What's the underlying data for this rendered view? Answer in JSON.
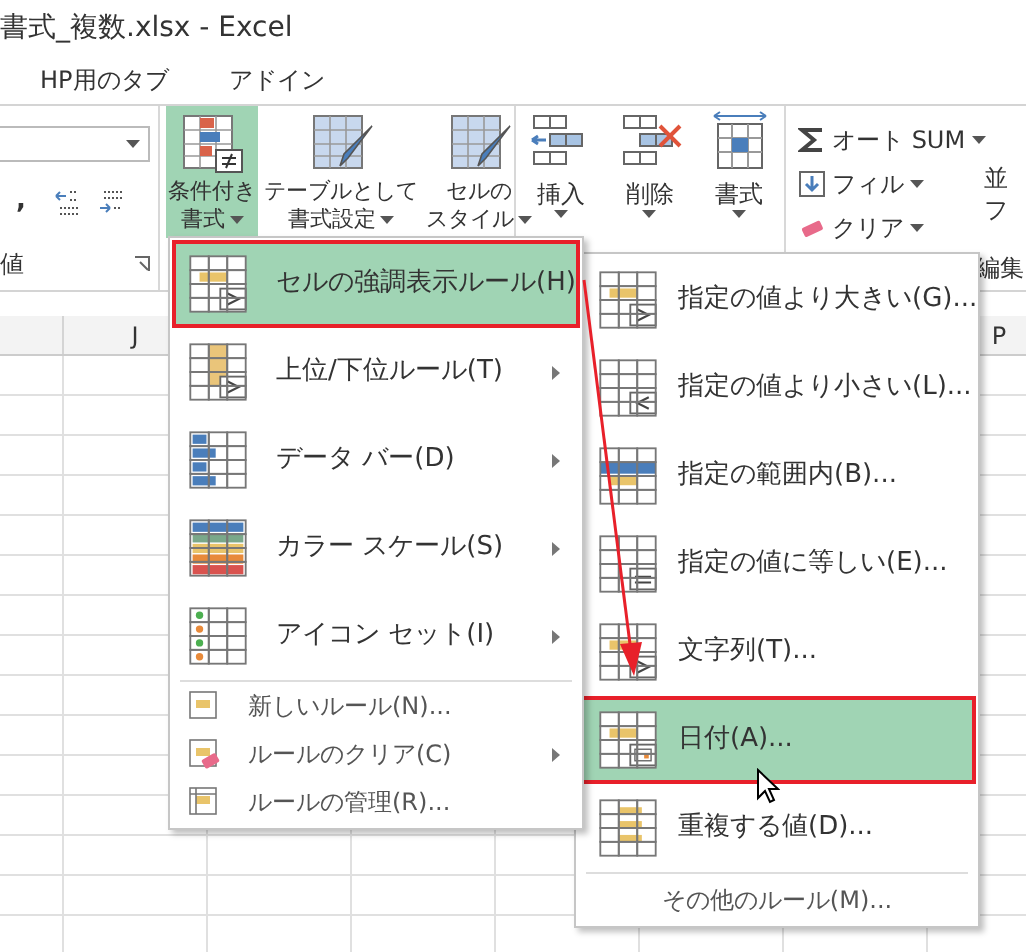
{
  "window": {
    "title": "書式_複数.xlsx - Excel"
  },
  "tabs": [
    {
      "label": "HP用のタブ"
    },
    {
      "label": "アドイン"
    }
  ],
  "number_group": {
    "comma": ",",
    "label": "値"
  },
  "style_buttons": [
    {
      "lines": [
        "条件付き",
        "書式"
      ],
      "selected": true
    },
    {
      "lines": [
        "テーブルとして",
        "書式設定"
      ],
      "selected": false
    },
    {
      "lines": [
        "セルの",
        "スタイル"
      ],
      "selected": false
    }
  ],
  "cell_buttons": [
    {
      "label": "挿入"
    },
    {
      "label": "削除"
    },
    {
      "label": "書式"
    }
  ],
  "editing": {
    "items": [
      {
        "label": "オート SUM"
      },
      {
        "label": "フィル"
      },
      {
        "label": "クリア"
      }
    ],
    "sort_label": [
      "並",
      "フ"
    ],
    "label": "編集"
  },
  "columns": [
    "J",
    "P"
  ],
  "menu": {
    "items": [
      {
        "kind": "large",
        "label": "セルの強調表示ルール(H)",
        "submenu": true,
        "selected": true,
        "annotated": true
      },
      {
        "kind": "large",
        "label": "上位/下位ルール(T)",
        "submenu": true,
        "selected": false,
        "annotated": false
      },
      {
        "kind": "large",
        "label": "データ バー(D)",
        "submenu": true,
        "selected": false,
        "annotated": false
      },
      {
        "kind": "large",
        "label": "カラー スケール(S)",
        "submenu": true,
        "selected": false,
        "annotated": false
      },
      {
        "kind": "large",
        "label": "アイコン セット(I)",
        "submenu": true,
        "selected": false,
        "annotated": false
      },
      {
        "kind": "small",
        "label": "新しいルール(N)...",
        "submenu": false,
        "selected": false,
        "annotated": false
      },
      {
        "kind": "small",
        "label": "ルールのクリア(C)",
        "submenu": true,
        "selected": false,
        "annotated": false
      },
      {
        "kind": "small",
        "label": "ルールの管理(R)...",
        "submenu": false,
        "selected": false,
        "annotated": false
      }
    ]
  },
  "submenu": {
    "items": [
      {
        "label": "指定の値より大きい(G)...",
        "selected": false,
        "annotated": false
      },
      {
        "label": "指定の値より小さい(L)...",
        "selected": false,
        "annotated": false
      },
      {
        "label": "指定の範囲内(B)...",
        "selected": false,
        "annotated": false
      },
      {
        "label": "指定の値に等しい(E)...",
        "selected": false,
        "annotated": false
      },
      {
        "label": "文字列(T)...",
        "selected": false,
        "annotated": false
      },
      {
        "label": "日付(A)...",
        "selected": true,
        "annotated": true
      },
      {
        "label": "重複する値(D)...",
        "selected": false,
        "annotated": false
      }
    ],
    "footer": "その他のルール(M)..."
  }
}
